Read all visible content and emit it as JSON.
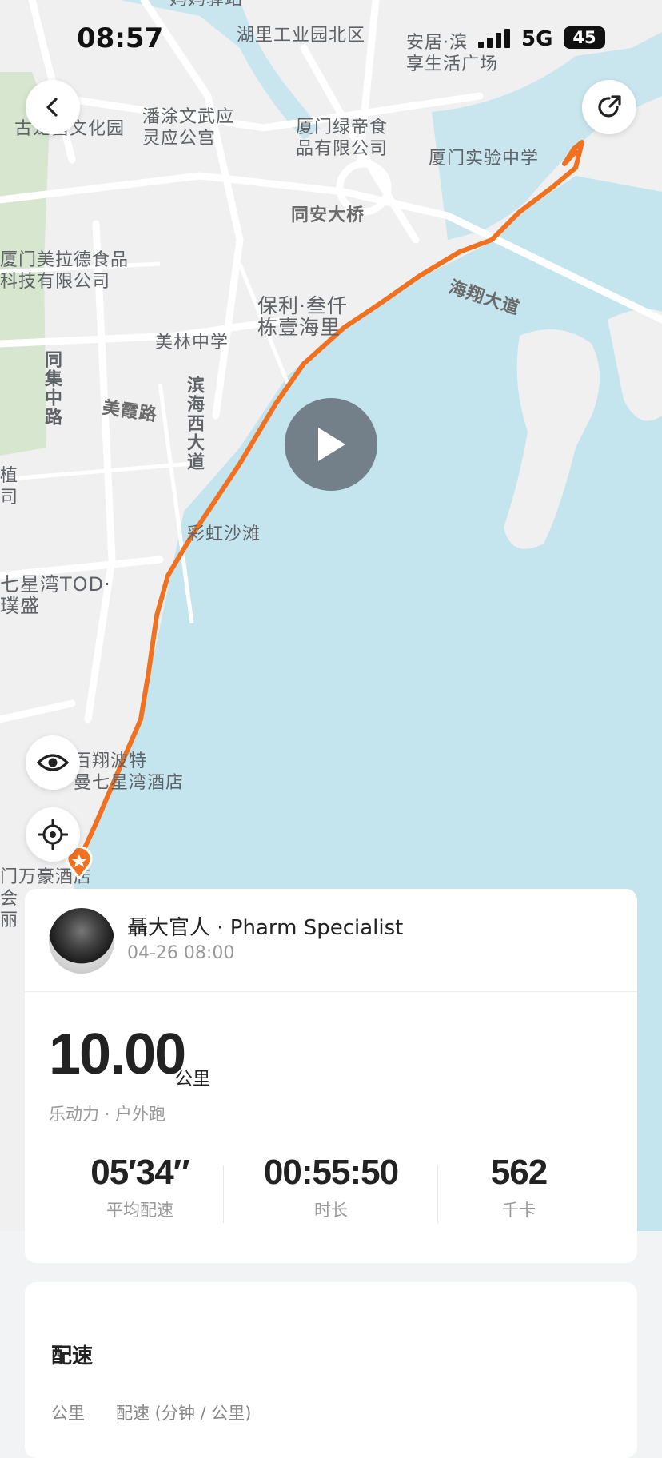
{
  "status": {
    "time": "08:57",
    "network": "5G",
    "battery": "45"
  },
  "map_labels": [
    {
      "text": "妈妈驿站",
      "cls": "maplabel"
    },
    {
      "text": "湖里工业园北区",
      "cls": "maplabel"
    },
    {
      "text": "安居·滨\n享生活广场",
      "cls": "maplabel"
    },
    {
      "text": "古龙酱文化园",
      "cls": "maplabel"
    },
    {
      "text": "潘涂文武应\n灵应公宫",
      "cls": "maplabel"
    },
    {
      "text": "厦门绿帝食\n品有限公司",
      "cls": "maplabel"
    },
    {
      "text": "厦门实验中学",
      "cls": "maplabel"
    },
    {
      "text": "同安大桥",
      "cls": "maplabel road"
    },
    {
      "text": "厦门美拉德食品\n科技有限公司",
      "cls": "maplabel"
    },
    {
      "text": "海翔大道",
      "cls": "maplabel road"
    },
    {
      "text": "保利·叁仟\n栋壹海里",
      "cls": "maplabel"
    },
    {
      "text": "美林中学",
      "cls": "maplabel"
    },
    {
      "text": "美霞路",
      "cls": "maplabel road"
    },
    {
      "text": "彩虹沙滩",
      "cls": "maplabel"
    },
    {
      "text": "植\n司",
      "cls": "maplabel"
    },
    {
      "text": "七星湾TOD·\n璞盛",
      "cls": "maplabel"
    },
    {
      "text": "百翔波特\n曼七星湾酒店",
      "cls": "maplabel"
    },
    {
      "text": "门万豪酒店\n会\n丽",
      "cls": "maplabel"
    }
  ],
  "map_vlabels": [
    "同集中路",
    "滨海西大道"
  ],
  "icons": {
    "back": "back-arrow-icon",
    "share": "share-icon",
    "play": "play-icon",
    "eye": "eye-icon",
    "locate": "locate-icon"
  },
  "route_color": "#f07221",
  "user": {
    "name": "聶大官人 · Pharm Specialist",
    "datetime": "04-26 08:00"
  },
  "summary": {
    "distance": "10.00",
    "distance_unit": "公里",
    "sport": "乐动力 · 户外跑",
    "stats": [
      {
        "value": "05′34″",
        "label": "平均配速"
      },
      {
        "value": "00:55:50",
        "label": "时长"
      },
      {
        "value": "562",
        "label": "千卡"
      }
    ]
  },
  "pace": {
    "title": "配速",
    "col_km": "公里",
    "col_pace": "配速 (分钟 / 公里)"
  }
}
